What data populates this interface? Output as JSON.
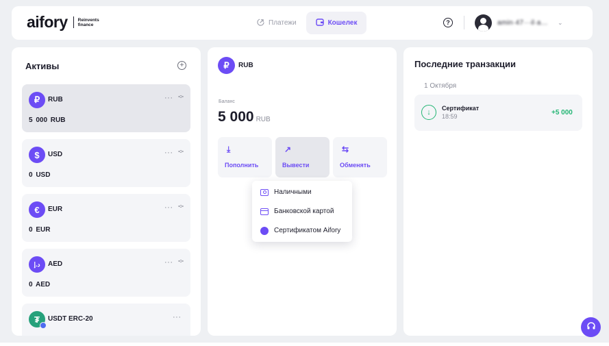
{
  "header": {
    "logo": "aifory",
    "tagline_1": "Reinvents",
    "tagline_2": "finance",
    "nav": [
      {
        "label": "Платежи",
        "icon": "arrow-up-right-icon"
      },
      {
        "label": "Кошелек",
        "icon": "wallet-icon"
      }
    ],
    "help_icon": "?",
    "user_name": "amin·47···il·a…"
  },
  "assets": {
    "title": "Активы",
    "items": [
      {
        "symbol": "₽",
        "code": "RUB",
        "balance": "5 000  RUB",
        "color": "#6c4cf5"
      },
      {
        "symbol": "$",
        "code": "USD",
        "balance": "0  USD",
        "color": "#6c4cf5"
      },
      {
        "symbol": "€",
        "code": "EUR",
        "balance": "0  EUR",
        "color": "#6c4cf5"
      },
      {
        "symbol": "د.إ",
        "code": "AED",
        "balance": "0  AED",
        "color": "#6c4cf5"
      },
      {
        "symbol": "₮",
        "code": "USDT ERC-20",
        "balance": "",
        "color": "#26a17b"
      }
    ]
  },
  "wallet": {
    "symbol": "₽",
    "code": "RUB",
    "balance_label": "Баланс",
    "balance_value": "5 000",
    "balance_currency": "RUB",
    "actions": [
      {
        "label": "Пополнить",
        "icon": "⤓"
      },
      {
        "label": "Вывести",
        "icon": "↗"
      },
      {
        "label": "Обменять",
        "icon": "⇆"
      }
    ],
    "withdraw_menu": [
      {
        "label": "Наличными",
        "icon": "cash-icon"
      },
      {
        "label": "Банковской картой",
        "icon": "card-icon"
      },
      {
        "label": "Сертификатом Aifory",
        "icon": "certificate-icon"
      }
    ]
  },
  "transactions": {
    "title": "Последние транзакции",
    "date": "1 Октября",
    "items": [
      {
        "name": "Сертификат",
        "time": "18:59",
        "amount": "+5 000"
      }
    ]
  }
}
